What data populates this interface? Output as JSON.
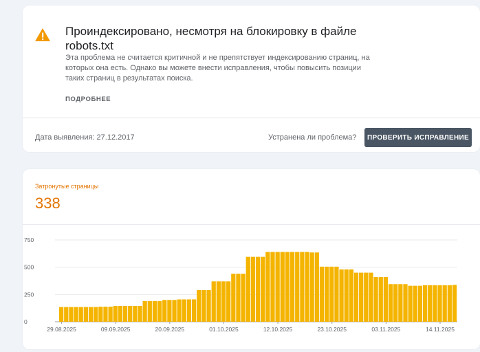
{
  "issue": {
    "title": "Проиндексировано, несмотря на блокировку в файле robots.txt",
    "description": "Эта проблема не считается критичной и не препятствует индексированию страниц, на которых она есть. Однако вы можете внести исправления, чтобы повысить позиции таких страниц в результатах поиска.",
    "learn_more": "ПОДРОБНЕЕ",
    "detection_date": "Дата выявления: 27.12.2017",
    "resolved_question": "Устранена ли проблема?",
    "verify_button": "ПРОВЕРИТЬ ИСПРАВЛЕНИЕ",
    "warning_icon": "warning-triangle-icon",
    "warning_color": "#f29900"
  },
  "metric": {
    "label": "Затронутые страницы",
    "value": "338",
    "color": "#e37400"
  },
  "chart_data": {
    "type": "bar",
    "title": "",
    "xlabel": "",
    "ylabel": "",
    "ylim": [
      0,
      750
    ],
    "yticks": [
      0,
      250,
      500,
      750
    ],
    "ytick_labels": [
      "0",
      "250",
      "500",
      "750"
    ],
    "x_tick_labels": [
      "29.08.2025",
      "09.09.2025",
      "20.09.2025",
      "01.10.2025",
      "12.10.2025",
      "23.10.2025",
      "03.11.2025",
      "14.11.2025"
    ],
    "x_tick_indices": [
      0,
      11,
      22,
      33,
      44,
      55,
      66,
      77
    ],
    "bar_color": "#f4b400",
    "grid": true,
    "values": [
      135,
      135,
      135,
      135,
      135,
      135,
      135,
      135,
      138,
      138,
      138,
      145,
      145,
      145,
      145,
      145,
      145,
      190,
      190,
      190,
      190,
      200,
      200,
      200,
      205,
      205,
      205,
      205,
      290,
      290,
      290,
      370,
      370,
      370,
      370,
      440,
      440,
      440,
      595,
      595,
      595,
      595,
      640,
      640,
      640,
      640,
      640,
      640,
      640,
      640,
      640,
      635,
      635,
      505,
      505,
      505,
      505,
      480,
      480,
      480,
      450,
      450,
      450,
      450,
      410,
      410,
      410,
      345,
      345,
      345,
      345,
      330,
      330,
      330,
      335,
      335,
      335,
      335,
      335,
      335,
      338
    ]
  }
}
